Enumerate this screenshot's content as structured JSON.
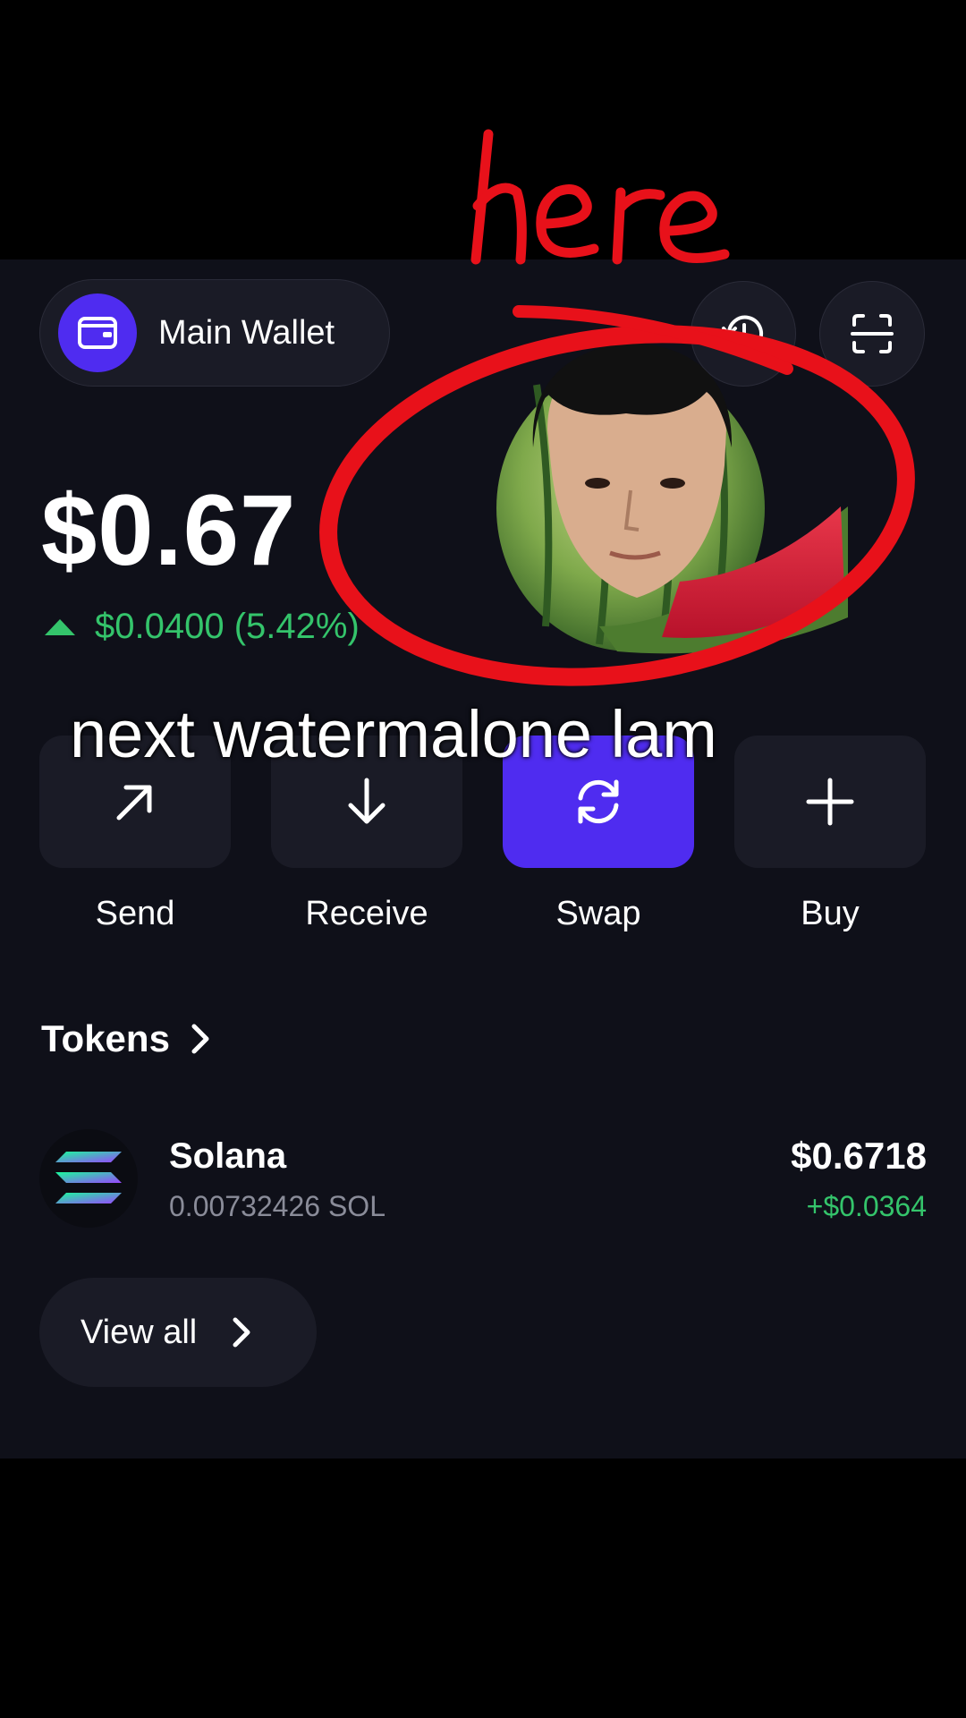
{
  "overlay": {
    "annotation": "here",
    "caption": "next watermalone lam"
  },
  "header": {
    "wallet_label": "Main Wallet",
    "wallet_icon": "wallet-icon",
    "history_icon": "history-icon",
    "scan_icon": "scan-icon"
  },
  "balance": {
    "total": "$0.67",
    "change": "$0.0400 (5.42%)",
    "direction": "up"
  },
  "actions": [
    {
      "label": "Send",
      "icon": "arrow-up-right-icon"
    },
    {
      "label": "Receive",
      "icon": "arrow-down-icon"
    },
    {
      "label": "Swap",
      "icon": "swap-icon"
    },
    {
      "label": "Buy",
      "icon": "plus-icon"
    }
  ],
  "tokens": {
    "header": "Tokens",
    "items": [
      {
        "name": "Solana",
        "amount": "0.00732426 SOL",
        "value": "$0.6718",
        "change": "+$0.0364"
      }
    ],
    "view_all": "View all"
  },
  "colors": {
    "background": "#0f1019",
    "accent": "#4f2cf0",
    "positive": "#34c46b",
    "annotation": "#e8111a"
  }
}
